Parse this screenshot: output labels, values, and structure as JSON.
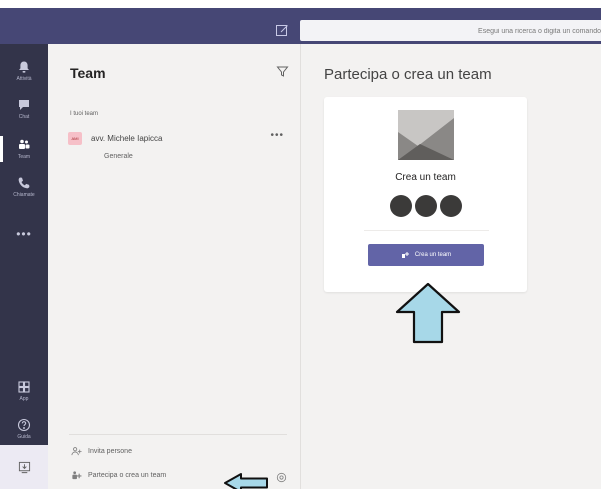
{
  "search": {
    "placeholder": "Esegui una ricerca o digita un comando"
  },
  "rail": {
    "items": [
      {
        "label": "Attività",
        "icon": "bell-icon"
      },
      {
        "label": "Chat",
        "icon": "chat-icon"
      },
      {
        "label": "Team",
        "icon": "teams-icon"
      },
      {
        "label": "Chiamate",
        "icon": "phone-icon"
      },
      {
        "label": "App",
        "icon": "apps-icon"
      },
      {
        "label": "Guida",
        "icon": "help-icon"
      }
    ],
    "more_label": "•••"
  },
  "panel": {
    "title": "Team",
    "section_label": "I tuoi team",
    "team": {
      "avatar": "AMI",
      "name": "avv. Michele Iapicca",
      "more": "•••"
    },
    "channel": "Generale",
    "invite_label": "Invita persone",
    "join_label": "Partecipa o crea un team"
  },
  "main": {
    "title": "Partecipa o crea un team",
    "card_title": "Crea un team",
    "create_button": "Crea un team"
  },
  "colors": {
    "brand": "#464775",
    "rail": "#33344a",
    "accent": "#6264a7",
    "arrow_fill": "#a7d8e8"
  }
}
